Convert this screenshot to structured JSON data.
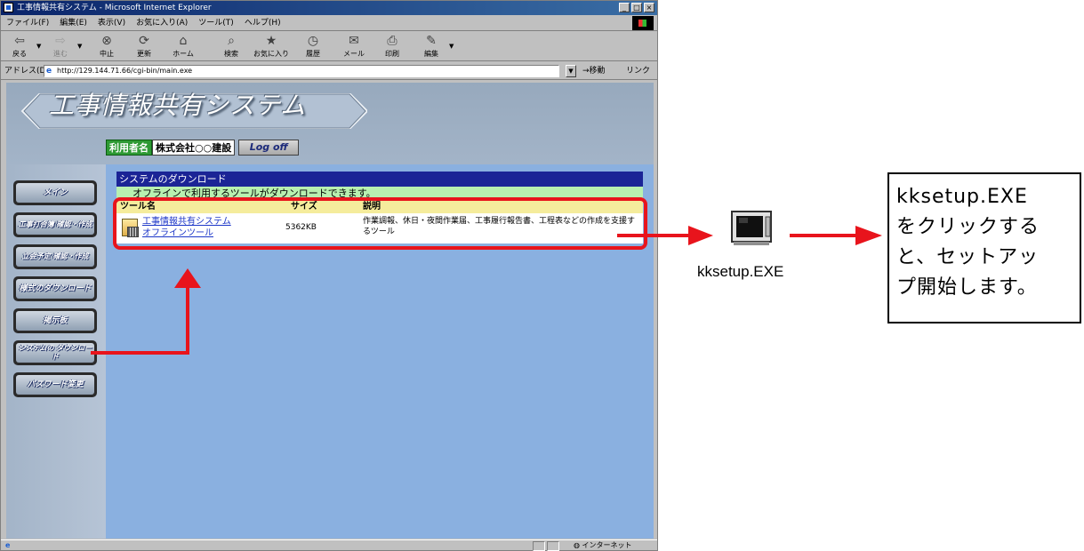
{
  "window": {
    "title": "工事情報共有システム - Microsoft Internet Explorer",
    "buttons": [
      "_",
      "□",
      "×"
    ]
  },
  "menu": [
    "ファイル(F)",
    "編集(E)",
    "表示(V)",
    "お気に入り(A)",
    "ツール(T)",
    "ヘルプ(H)"
  ],
  "toolbar": {
    "back": "戻る",
    "forward": "進む",
    "stop": "中止",
    "refresh": "更新",
    "home": "ホーム",
    "search": "検索",
    "favorites": "お気に入り",
    "history": "履歴",
    "mail": "メール",
    "print": "印刷",
    "edit": "編集"
  },
  "address": {
    "label": "アドレス(D)",
    "url": "http://129.144.71.66/cgi-bin/main.exe",
    "go": "移動",
    "links": "リンク »"
  },
  "app": {
    "title": "工事情報共有システム",
    "user_label": "利用者名",
    "user_name": "株式会社○○建設",
    "logoff": "Log off"
  },
  "nav": [
    "メイン",
    "工事打合簿 確認・作成",
    "立会予定 確認・作成",
    "様式のダウンロード",
    "掲示板",
    "システムの ダウンロード",
    "パスワード変更"
  ],
  "section": {
    "title": "システムのダウンロード",
    "description": "オフラインで利用するツールがダウンロードできます。"
  },
  "table": {
    "headers": [
      "ツール名",
      "サイズ",
      "説明"
    ],
    "rows": [
      {
        "name_line1": "工事情報共有システム",
        "name_line2": "オフラインツール",
        "size": "5362KB",
        "description": "作業調報、休日・夜間作業届、工事履行報告書、工程表などの作成を支援するツール"
      }
    ]
  },
  "status": {
    "zone": "インターネット"
  },
  "annotation": {
    "file_label": "kksetup.EXE",
    "callout_lines": [
      "kksetup.EXE",
      "をクリックする",
      "と、セットアッ",
      "プ開始します。"
    ]
  },
  "colors": {
    "highlight_red": "#e8141c",
    "section_title_bg": "#1b2496",
    "user_label_bg": "#2e9a34"
  }
}
